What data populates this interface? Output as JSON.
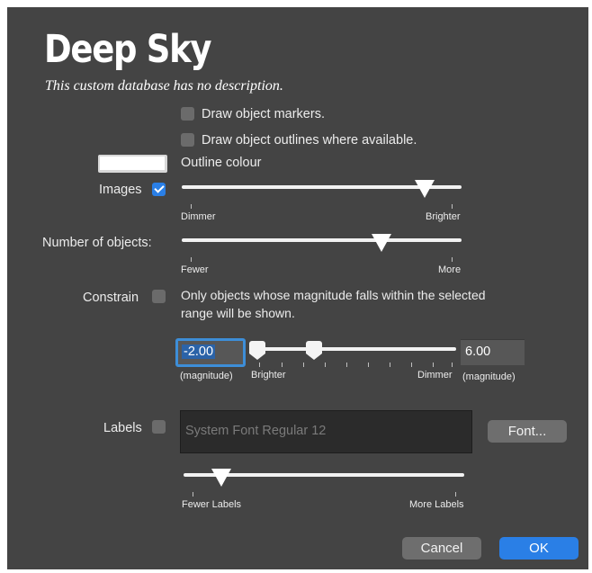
{
  "title": "Deep Sky",
  "subtitle": "This custom database has no description.",
  "markers": {
    "label": "Draw object markers.",
    "checked": false
  },
  "outlines": {
    "label": "Draw object outlines where available.",
    "checked": false
  },
  "outline_colour": {
    "label": "Outline colour",
    "swatch": "#ffffff"
  },
  "images": {
    "label": "Images",
    "checked": true,
    "slider_min": "Dimmer",
    "slider_max": "Brighter",
    "slider_value": 0.86
  },
  "number_of_objects": {
    "label": "Number of objects:",
    "slider_min": "Fewer",
    "slider_max": "More",
    "slider_value": 0.71
  },
  "constrain": {
    "label": "Constrain",
    "checked": false,
    "description_line1": "Only objects whose magnitude falls within the selected",
    "description_line2": "range will be shown.",
    "min_value": "-2.00",
    "max_value": "6.00",
    "min_unit": "(magnitude)",
    "max_unit": "(magnitude)",
    "slider_left_label": "Brighter",
    "slider_right_label": "Dimmer"
  },
  "labels": {
    "label": "Labels",
    "checked": false,
    "font_display": "System Font Regular 12",
    "font_button": "Font...",
    "slider_min": "Fewer Labels",
    "slider_max": "More Labels",
    "slider_value": 0.14
  },
  "buttons": {
    "cancel": "Cancel",
    "ok": "OK"
  },
  "colors": {
    "panel": "#444444",
    "accent": "#2a7fe6",
    "text": "#ececec"
  }
}
